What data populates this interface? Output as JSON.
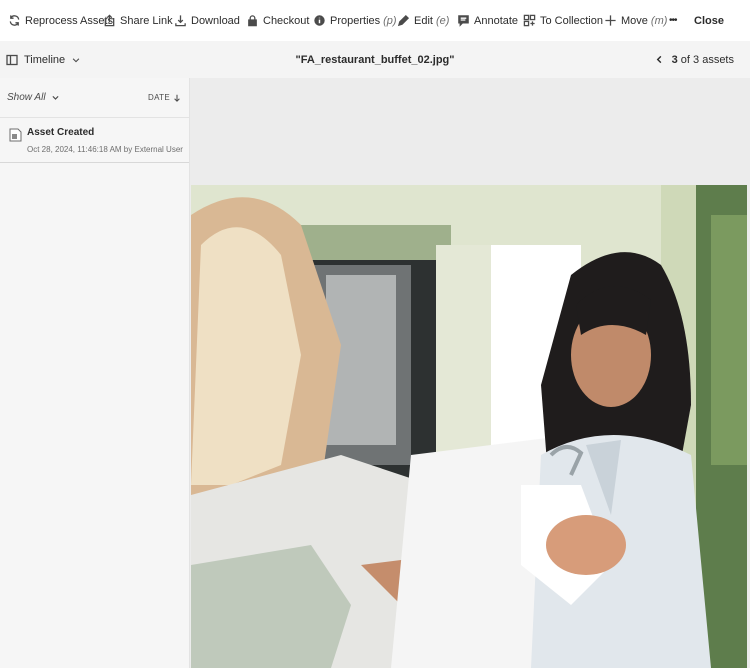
{
  "toolbar": {
    "items": [
      {
        "label": "Reprocess Assets",
        "icon": "refresh-icon",
        "shortcut": ""
      },
      {
        "label": "Share Link",
        "icon": "share-icon",
        "shortcut": ""
      },
      {
        "label": "Download",
        "icon": "download-icon",
        "shortcut": ""
      },
      {
        "label": "Checkout",
        "icon": "lock-icon",
        "shortcut": ""
      },
      {
        "label": "Properties",
        "icon": "info-icon",
        "shortcut": "(p)"
      },
      {
        "label": "Edit",
        "icon": "pencil-icon",
        "shortcut": "(e)"
      },
      {
        "label": "Annotate",
        "icon": "comment-icon",
        "shortcut": ""
      },
      {
        "label": "To Collection",
        "icon": "collection-icon",
        "shortcut": ""
      },
      {
        "label": "Move",
        "icon": "plus-icon",
        "shortcut": "(m)"
      }
    ],
    "more_label": "•••",
    "close_label": "Close"
  },
  "subbar": {
    "rail_label": "Timeline",
    "file_title": "\"FA_restaurant_buffet_02.jpg\"",
    "pager": {
      "current": "3",
      "suffix": "of 3 assets"
    }
  },
  "rail": {
    "filter_label": "Show All",
    "sort_label": "DATE",
    "events": [
      {
        "title": "Asset Created",
        "meta": "Oct 28, 2024, 11:46:18 AM by External User"
      }
    ]
  },
  "colors": {
    "toolbar_bg": "#ffffff",
    "rail_bg": "#f6f6f6",
    "stage_bg": "#ececec",
    "text": "#2c2c2c"
  }
}
